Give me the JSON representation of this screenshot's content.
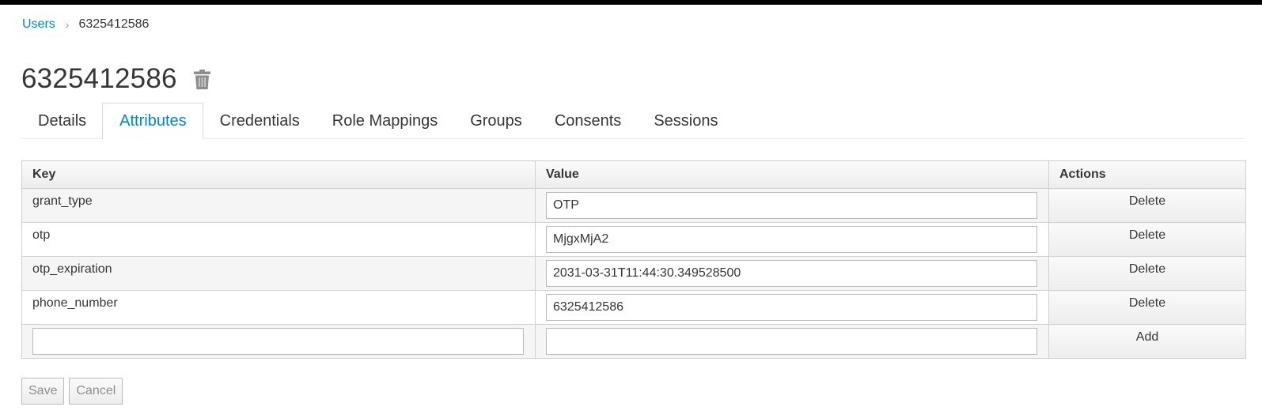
{
  "breadcrumb": {
    "parent": "Users",
    "separator": "›",
    "current": "6325412586"
  },
  "page": {
    "title": "6325412586",
    "delete_icon": "trash-icon"
  },
  "tabs": [
    {
      "label": "Details",
      "active": false
    },
    {
      "label": "Attributes",
      "active": true
    },
    {
      "label": "Credentials",
      "active": false
    },
    {
      "label": "Role Mappings",
      "active": false
    },
    {
      "label": "Groups",
      "active": false
    },
    {
      "label": "Consents",
      "active": false
    },
    {
      "label": "Sessions",
      "active": false
    }
  ],
  "table": {
    "headers": {
      "key": "Key",
      "value": "Value",
      "actions": "Actions"
    },
    "rows": [
      {
        "key": "grant_type",
        "value": "OTP",
        "action": "Delete"
      },
      {
        "key": "otp",
        "value": "MjgxMjA2",
        "action": "Delete"
      },
      {
        "key": "otp_expiration",
        "value": "2031-03-31T11:44:30.349528500",
        "action": "Delete"
      },
      {
        "key": "phone_number",
        "value": "6325412586",
        "action": "Delete"
      }
    ],
    "new_row": {
      "key": "",
      "value": "",
      "action": "Add"
    }
  },
  "buttons": {
    "save": "Save",
    "cancel": "Cancel"
  },
  "colors": {
    "link": "#0088ce",
    "text": "#363636",
    "border": "#d1d1d1"
  }
}
